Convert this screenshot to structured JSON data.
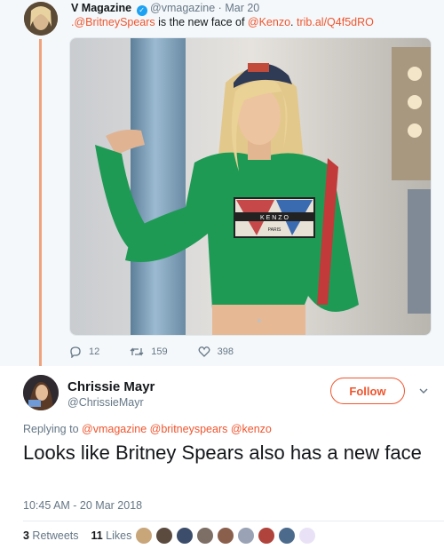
{
  "parent_tweet": {
    "author_name": "V Magazine",
    "verified_mark": "✓",
    "handle": "@vmagazine",
    "separator": "·",
    "date": "Mar 20",
    "text_mention": ".@BritneySpears",
    "text_middle": " is the new face of ",
    "text_mention2": "@Kenzo",
    "text_period": ".",
    "text_link": " trib.al/Q4f5dRO",
    "photo_caption_brand": "K E N Z O",
    "photo_caption_city": "PARIS",
    "replies": "12",
    "retweets": "159",
    "likes": "398"
  },
  "main_tweet": {
    "author_name": "Chrissie Mayr",
    "handle": "@ChrissieMayr",
    "follow_label": "Follow",
    "replying_to_label": "Replying to ",
    "replying_to_handles": "@vmagazine @britneyspears @kenzo",
    "text": "Looks like Britney Spears also has a new face",
    "timestamp": "10:45 AM - 20 Mar 2018",
    "retweets_count": "3",
    "retweets_label": " Retweets",
    "likes_count": "11",
    "likes_label": " Likes"
  },
  "colors": {
    "accent": "#f0552e",
    "verified": "#1da1f2",
    "muted_text": "#657786",
    "jersey_green": "#1e9a55",
    "pole_blue": "#7ea4c0"
  },
  "icons": [
    "verified-icon",
    "reply-icon",
    "retweet-icon",
    "like-icon",
    "chevron-down-icon"
  ]
}
